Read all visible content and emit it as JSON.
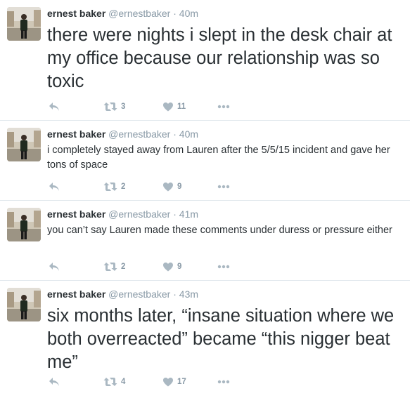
{
  "tweets": [
    {
      "name": "ernest baker",
      "handle": "@ernestbaker",
      "separator": "·",
      "time": "40m",
      "text": "there were nights i slept in the desk chair at my office because our relationship was so toxic",
      "retweets": "3",
      "likes": "11"
    },
    {
      "name": "ernest baker",
      "handle": "@ernestbaker",
      "separator": "·",
      "time": "40m",
      "text": "i completely stayed away from Lauren after the 5/5/15 incident and gave her tons of space",
      "retweets": "2",
      "likes": "9"
    },
    {
      "name": "ernest baker",
      "handle": "@ernestbaker",
      "separator": "·",
      "time": "41m",
      "text": "you can’t say Lauren made these comments under duress or pressure either",
      "retweets": "2",
      "likes": "9"
    },
    {
      "name": "ernest baker",
      "handle": "@ernestbaker",
      "separator": "·",
      "time": "43m",
      "text": "six months later, “insane situation where we both overreacted” became “this nigger beat me”",
      "retweets": "4",
      "likes": "17"
    }
  ],
  "icons": {
    "reply": "reply-icon",
    "retweet": "retweet-icon",
    "like": "heart-icon",
    "more": "more-icon"
  },
  "colors": {
    "text": "#292f33",
    "muted": "#8899a6",
    "icon": "#aab8c2",
    "divider": "#e1e8ed"
  }
}
